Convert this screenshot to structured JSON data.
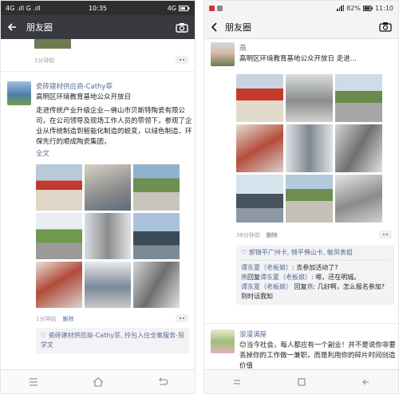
{
  "left": {
    "status": {
      "carrier": "4G .ıll G .ıll",
      "time": "10:35",
      "battery": "4G"
    },
    "nav": {
      "back_icon": "back-arrow-icon",
      "title": "朋友圈",
      "camera_icon": "camera-icon"
    },
    "prev_post": {
      "time": "1分钟前"
    },
    "post": {
      "author": "瓷砖建材供应商-Cathy菲",
      "title": "高明区环境教育基地公众开放日",
      "body": "走进传统产业升级企业—佛山市贝斯特陶瓷有限公司，在公司领导及现场工作人员的带领下，参观了企业从传统制造到智能化制造的蜕变，以绿色制造、环保先行的顺成陶瓷集团，",
      "full_text": "全文",
      "time": "1分钟前",
      "delete": "删除",
      "likes": "瓷砖建材供应商-Cathy菲, 拎包入住全案服务-贸学文"
    }
  },
  "right": {
    "status": {
      "time": "11:10",
      "battery": "82%"
    },
    "nav": {
      "back_icon": "back-chevron-icon",
      "title": "朋友圈",
      "camera_icon": "camera-icon"
    },
    "post": {
      "author": "燕",
      "title": "高明区环境教育基地公众开放日  走进...",
      "time": "38分钟前",
      "delete": "删除",
      "likes": "郭锦平广州卡, 锦平佛山卡, 敏凤表姐",
      "comments": [
        {
          "name": "谭东夏（老板娘）",
          "sep": ": ",
          "reply_to": "",
          "text": "去参加活动了?"
        },
        {
          "name": "燕",
          "sep": ": ",
          "reply_to": "谭东夏（老板娘）",
          "text": "嗯，还在明城。"
        },
        {
          "name": "谭东夏（老板娘）",
          "sep": ": ",
          "reply_to": "燕",
          "text": "几好啊，怎么报名参加? 到时话我知"
        }
      ]
    },
    "next_post": {
      "author": "浪漫满屋",
      "text": "😊当今社会，每人都应有一个副业！并不是说你非要丢掉你的工作做一兼职，而是利用你的碎片时间创造价值"
    }
  }
}
